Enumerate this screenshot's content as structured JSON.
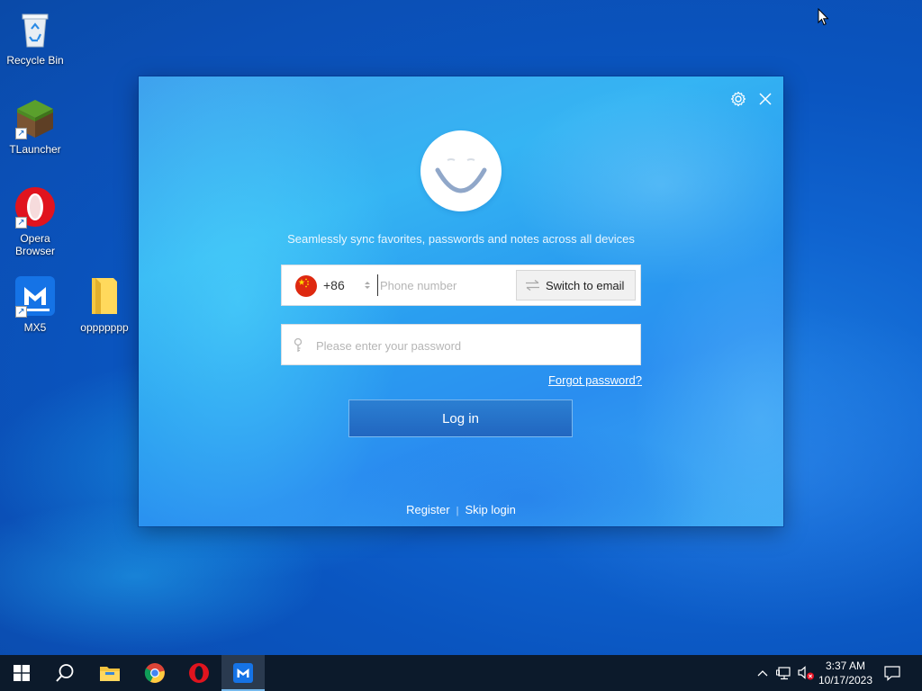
{
  "desktop": {
    "icons": [
      {
        "label": "Recycle Bin"
      },
      {
        "label": "TLauncher"
      },
      {
        "label": "Opera Browser"
      },
      {
        "label": "MX5"
      },
      {
        "label": "oppppppp"
      }
    ]
  },
  "dialog": {
    "tagline": "Seamlessly sync favorites, passwords and notes across all devices",
    "country_code": "+86",
    "phone_placeholder": "Phone number",
    "switch_label": "Switch to email",
    "password_placeholder": "Please enter your password",
    "forgot_label": "Forgot password?",
    "login_label": "Log in",
    "register_label": "Register",
    "separator": "|",
    "skip_label": "Skip login"
  },
  "taskbar": {
    "time": "3:37 AM",
    "date": "10/17/2023"
  },
  "colors": {
    "dialog_accent": "#2a9ef0",
    "login_button": "#2166c0",
    "taskbar": "#0c1a2b"
  }
}
